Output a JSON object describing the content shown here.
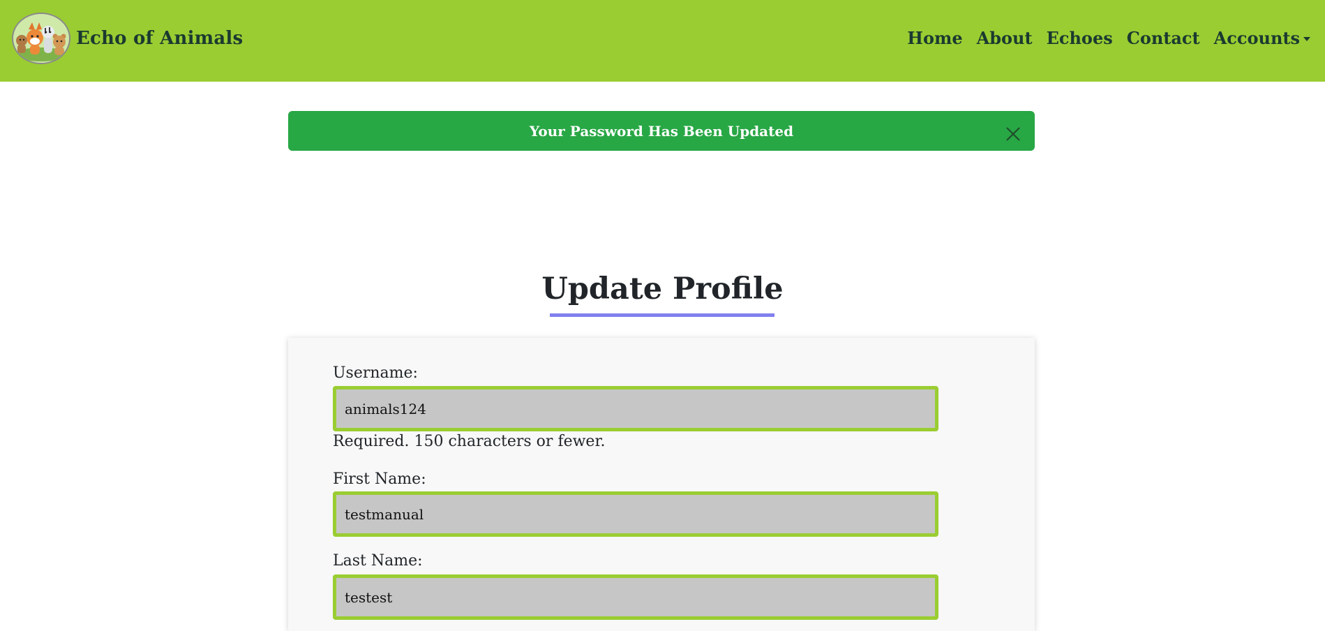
{
  "brand": {
    "name": "Echo of Animals",
    "logo_icon": "animal-friends-logo-icon"
  },
  "nav": {
    "items": [
      {
        "label": "Home"
      },
      {
        "label": "About"
      },
      {
        "label": "Echoes"
      },
      {
        "label": "Contact"
      },
      {
        "label": "Accounts",
        "dropdown": true
      }
    ]
  },
  "alert": {
    "message": "Your Password Has Been Updated",
    "close_icon": "close-icon",
    "color": "#28a745"
  },
  "page": {
    "title": "Update Profile"
  },
  "form": {
    "username": {
      "label": "Username:",
      "value": "animals124",
      "help": "Required. 150 characters or fewer."
    },
    "first_name": {
      "label": "First Name:",
      "value": "testmanual"
    },
    "last_name": {
      "label": "Last Name:",
      "value": "testest"
    }
  },
  "colors": {
    "navbar": "#9acd32",
    "alert_success": "#28a745",
    "title_underline": "#8080ee",
    "input_border": "#9acd32",
    "input_background": "#c6c6c6"
  }
}
